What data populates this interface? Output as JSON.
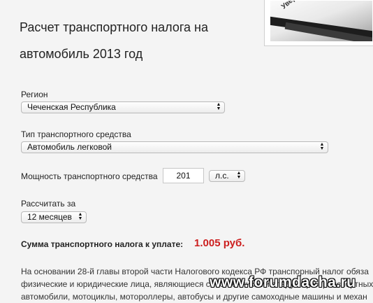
{
  "page": {
    "title": "Расчет транспортного налога на автомобиль 2013 год"
  },
  "form": {
    "region": {
      "label": "Регион",
      "value": "Чеченская Республика"
    },
    "vehicle_type": {
      "label": "Тип транспортного средства",
      "value": "Автомобиль легковой"
    },
    "power": {
      "label": "Мощность транспортного средства",
      "value": "201",
      "unit": "л.с."
    },
    "period": {
      "label": "Рассчитать за",
      "value": "12 месяцев"
    }
  },
  "result": {
    "label": "Сумма транспортного налога к уплате:",
    "value": "1.005 руб.",
    "color": "#cc1f1f"
  },
  "body": {
    "line1": "На основании 28-й главы второй части Налогового кодекса РФ транспорный налог обяза",
    "line2": "физические и юридические лица, являющиеся собственниками следующих транспортных",
    "line3": "автомобили, мотоциклы, мотороллеры, автобусы и другие самоходные машины и механ"
  },
  "watermark": {
    "text": "www.forumdacha.ru"
  },
  "icons": {
    "select_arrows": "up-down-arrows-icon",
    "photo": "car-wiper-photo"
  }
}
